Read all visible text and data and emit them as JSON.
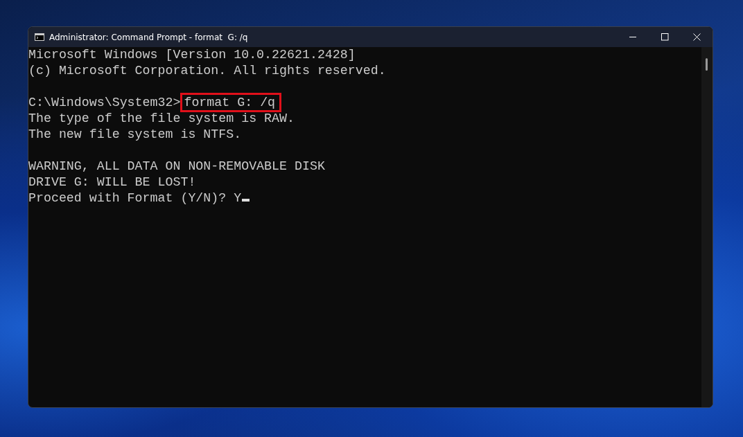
{
  "window": {
    "title": "Administrator: Command Prompt - format  G: /q"
  },
  "console": {
    "lines": [
      {
        "kind": "text",
        "text": "Microsoft Windows [Version 10.0.22621.2428]"
      },
      {
        "kind": "text",
        "text": "(c) Microsoft Corporation. All rights reserved."
      },
      {
        "kind": "blank"
      },
      {
        "kind": "command",
        "prompt": "C:\\Windows\\System32>",
        "command": "format G: /q",
        "highlighted": true
      },
      {
        "kind": "text",
        "text": "The type of the file system is RAW."
      },
      {
        "kind": "text",
        "text": "The new file system is NTFS."
      },
      {
        "kind": "blank"
      },
      {
        "kind": "text",
        "text": "WARNING, ALL DATA ON NON-REMOVABLE DISK"
      },
      {
        "kind": "text",
        "text": "DRIVE G: WILL BE LOST!"
      },
      {
        "kind": "input",
        "text": "Proceed with Format (Y/N)? Y"
      }
    ]
  }
}
